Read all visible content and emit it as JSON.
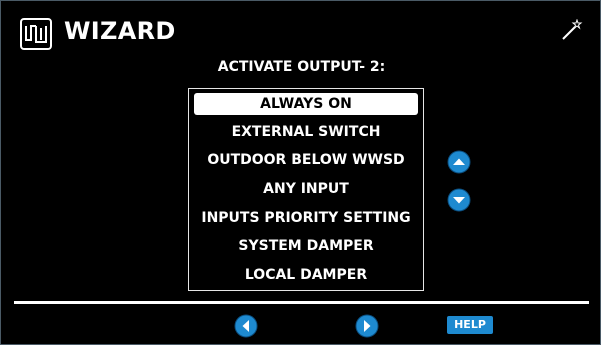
{
  "header": {
    "title": "WIZARD",
    "logo_icon": "wm-logo-icon",
    "wizard_icon": "magic-wand-icon"
  },
  "prompt": "ACTIVATE OUTPUT- 2:",
  "options": [
    {
      "label": "ALWAYS ON",
      "selected": true
    },
    {
      "label": "EXTERNAL SWITCH",
      "selected": false
    },
    {
      "label": "OUTDOOR BELOW WWSD",
      "selected": false
    },
    {
      "label": "ANY INPUT",
      "selected": false
    },
    {
      "label": "INPUTS PRIORITY SETTING",
      "selected": false
    },
    {
      "label": "SYSTEM DAMPER",
      "selected": false
    },
    {
      "label": "LOCAL DAMPER",
      "selected": false
    }
  ],
  "scroll": {
    "up_icon": "chevron-up-icon",
    "down_icon": "chevron-down-icon"
  },
  "footer": {
    "back_icon": "chevron-left-icon",
    "next_icon": "chevron-right-icon",
    "help_label": "HELP"
  },
  "colors": {
    "background": "#000000",
    "accent": "#1e8ad0",
    "text": "#ffffff"
  }
}
